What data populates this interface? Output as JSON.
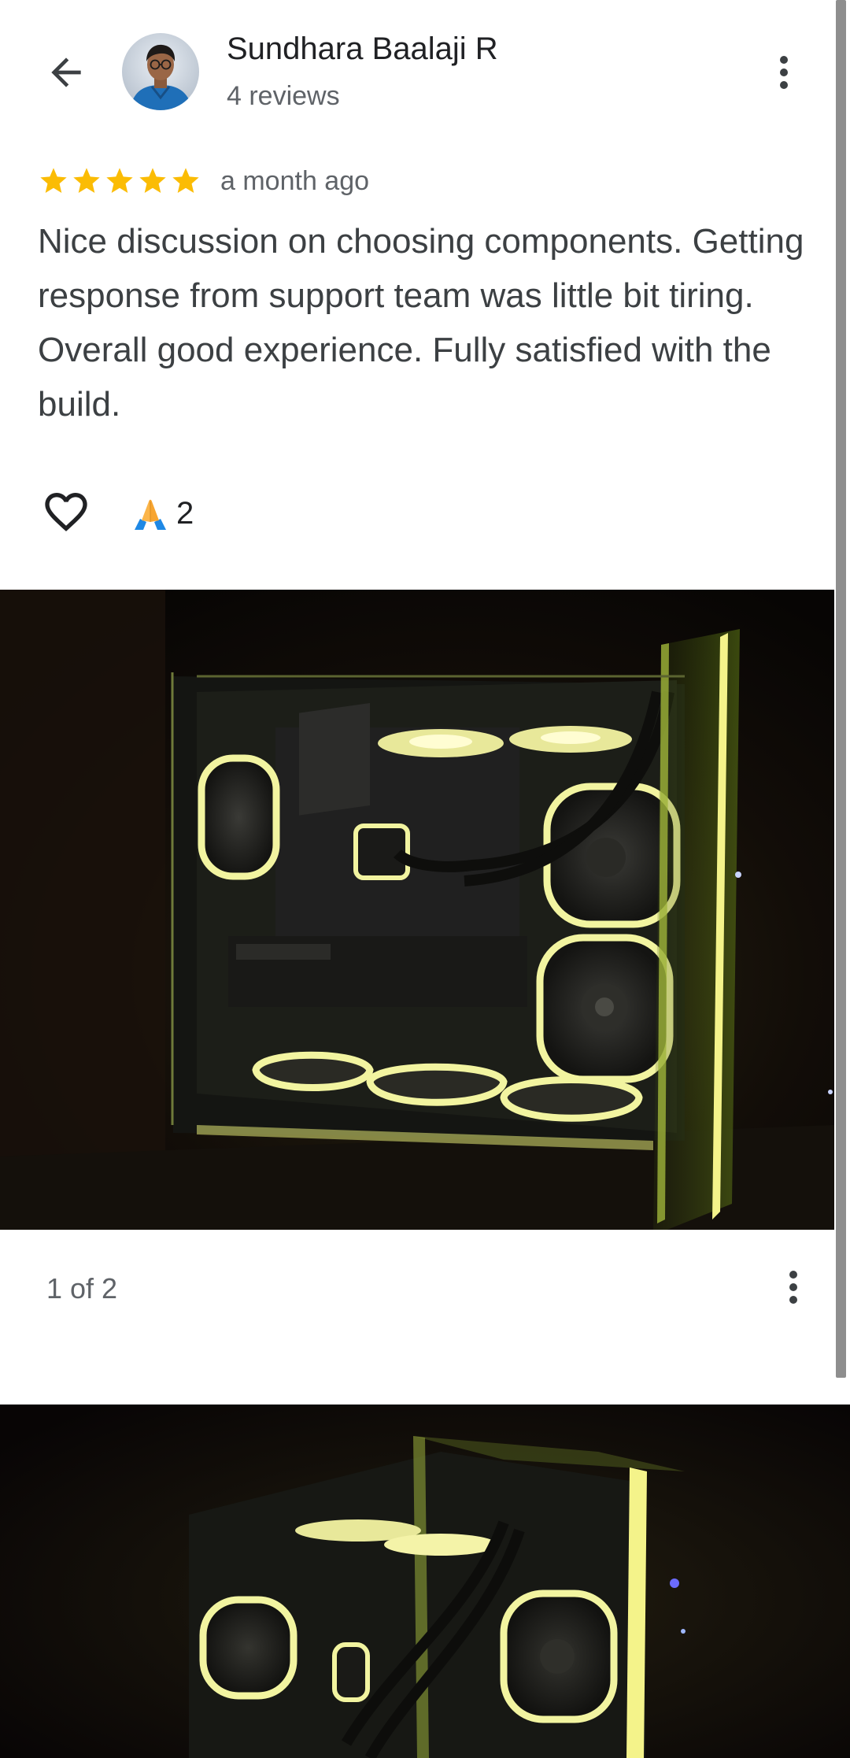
{
  "header": {
    "back_icon": "arrow-left-icon",
    "user_name": "Sundhara Baalaji R",
    "reviews_count": "4 reviews",
    "more_icon": "more-vert-icon"
  },
  "review": {
    "rating": 5,
    "rating_max": 5,
    "star_color": "#fbbc04",
    "time": "a month ago",
    "text": "Nice discussion on choosing components. Getting response from support team was little bit tiring. Overall good experience. Fully satisfied with the build."
  },
  "reactions": {
    "like_icon": "heart-outline-icon",
    "emoji_icon": "folded-hands-icon",
    "emoji_count": "2"
  },
  "photos": {
    "counter": "1 of 2",
    "more_icon": "more-vert-icon",
    "items": [
      {
        "description_icon": "photo-pc-build-1"
      },
      {
        "description_icon": "photo-pc-build-2"
      }
    ]
  },
  "colors": {
    "text_primary": "#202124",
    "text_secondary": "#5f6368",
    "text_body": "#3c4043",
    "accent_glow": "#f4f38a"
  }
}
